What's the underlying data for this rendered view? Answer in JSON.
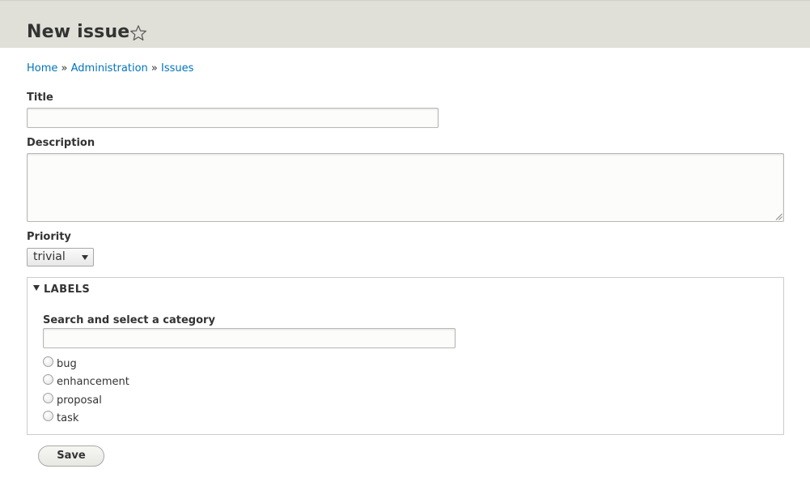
{
  "header": {
    "title": "New issue"
  },
  "breadcrumb": {
    "items": [
      "Home",
      "Administration",
      "Issues"
    ],
    "separator": "»"
  },
  "form": {
    "title_label": "Title",
    "title_value": "",
    "description_label": "Description",
    "description_value": "",
    "priority_label": "Priority",
    "priority_selected": "trivial"
  },
  "labels_fieldset": {
    "legend": "LABELS",
    "search_label": "Search and select a category",
    "search_value": "",
    "options": [
      "bug",
      "enhancement",
      "proposal",
      "task"
    ]
  },
  "actions": {
    "save_label": "Save"
  },
  "colors": {
    "header_bg": "#e0e0d8",
    "link": "#0074bd"
  },
  "icons": {
    "star": "star-outline-icon",
    "disclosure": "triangle-down-icon",
    "select_arrow": "chevron-down-icon",
    "resize": "resize-grip-icon"
  }
}
